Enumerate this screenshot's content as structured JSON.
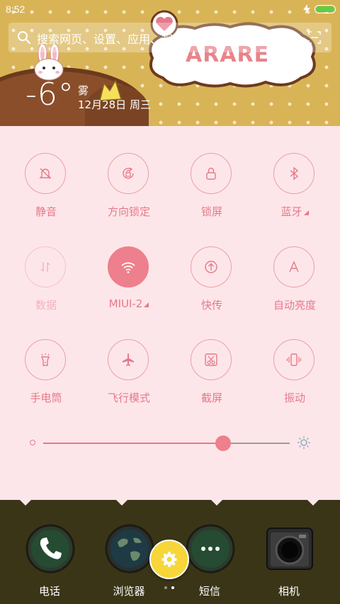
{
  "status_bar": {
    "time": "8:52",
    "charging_icon": "bolt-icon",
    "battery_color": "#5ad04a"
  },
  "search": {
    "placeholder": "搜索网页、设置、应用、视频…",
    "icon": "search-icon",
    "right_icon": "scan-icon"
  },
  "weather": {
    "temperature": "-6°",
    "condition": "雾",
    "date": "12月28日 周三"
  },
  "wallpaper": {
    "bubble_text": "ARARE"
  },
  "toggles": [
    {
      "label": "静音",
      "icon": "bell-off-icon",
      "state": "off"
    },
    {
      "label": "方向锁定",
      "icon": "rotation-lock-icon",
      "state": "off"
    },
    {
      "label": "锁屏",
      "icon": "lock-icon",
      "state": "off"
    },
    {
      "label": "蓝牙",
      "icon": "bluetooth-icon",
      "state": "off",
      "has_menu": true
    },
    {
      "label": "数据",
      "icon": "mobile-data-icon",
      "state": "disabled"
    },
    {
      "label": "MIUI-2",
      "icon": "wifi-icon",
      "state": "on",
      "has_menu": true
    },
    {
      "label": "快传",
      "icon": "quick-transfer-icon",
      "state": "off"
    },
    {
      "label": "自动亮度",
      "icon": "auto-brightness-icon",
      "state": "off"
    },
    {
      "label": "手电筒",
      "icon": "flashlight-icon",
      "state": "off"
    },
    {
      "label": "飞行模式",
      "icon": "airplane-icon",
      "state": "off"
    },
    {
      "label": "截屏",
      "icon": "screenshot-icon",
      "state": "off"
    },
    {
      "label": "振动",
      "icon": "vibrate-icon",
      "state": "off"
    }
  ],
  "brightness": {
    "level": 0.73,
    "low_icon": "brightness-low-icon",
    "high_icon": "brightness-high-icon"
  },
  "dock": {
    "apps": [
      {
        "label": "电话",
        "icon": "phone-icon"
      },
      {
        "label": "浏览器",
        "icon": "globe-icon"
      },
      {
        "label": "短信",
        "icon": "message-icon"
      },
      {
        "label": "相机",
        "icon": "camera-icon"
      }
    ],
    "settings_fab_icon": "gear-icon",
    "page_count": 2,
    "current_page": 2
  },
  "colors": {
    "accent": "#ee7f8d",
    "panel_bg": "#fde6e9",
    "label": "#e6798a",
    "dock_bg": "#3a3517"
  }
}
